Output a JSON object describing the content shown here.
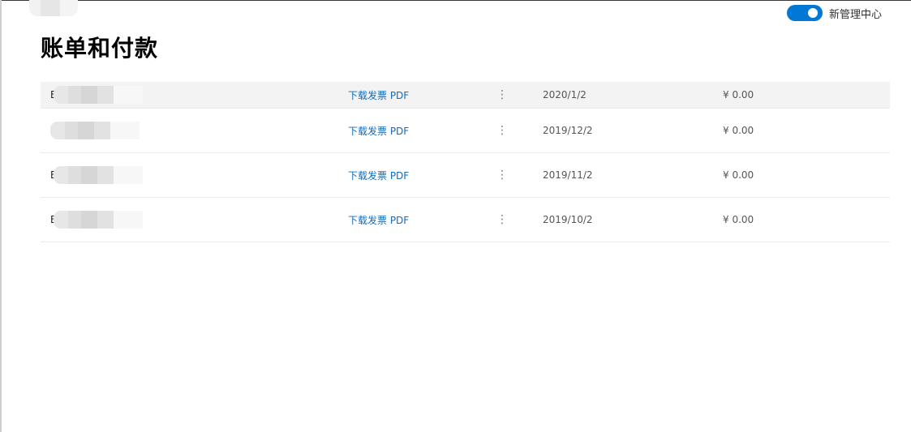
{
  "header": {
    "toggle_label": "新管理中心",
    "toggle_on": true
  },
  "page": {
    "title": "账单和付款"
  },
  "invoices": [
    {
      "name_initial": "E",
      "link": "下载发票 PDF",
      "more": "⋮",
      "date": "2020/1/2",
      "amount": "¥ 0.00"
    },
    {
      "name_initial": "",
      "link": "下载发票 PDF",
      "more": "⋮",
      "date": "2019/12/2",
      "amount": "¥ 0.00"
    },
    {
      "name_initial": "E",
      "link": "下载发票 PDF",
      "more": "⋮",
      "date": "2019/11/2",
      "amount": "¥ 0.00"
    },
    {
      "name_initial": "E",
      "link": "下载发票 PDF",
      "more": "⋮",
      "date": "2019/10/2",
      "amount": "¥ 0.00"
    }
  ],
  "colors": {
    "accent": "#0078d4",
    "link": "#0f6cbd"
  }
}
